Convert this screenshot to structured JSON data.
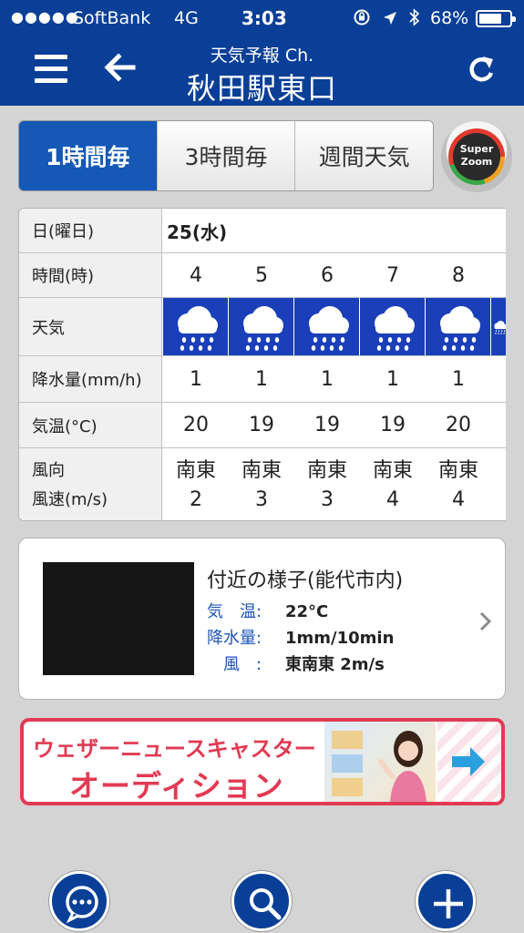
{
  "status_bar": {
    "signal": "●●●●●",
    "carrier": "SoftBank",
    "network": "4G",
    "time": "3:03",
    "battery_percent": "68%",
    "battery_level": 0.68
  },
  "header": {
    "subtitle": "天気予報 Ch.",
    "title": "秋田駅東口"
  },
  "tabs": [
    {
      "label": "1時間毎",
      "active": true
    },
    {
      "label": "3時間毎",
      "active": false
    },
    {
      "label": "週間天気",
      "active": false
    }
  ],
  "super_zoom": {
    "line1": "Super",
    "line2": "Zoom"
  },
  "forecast": {
    "labels": {
      "day": "日(曜日)",
      "hour": "時間(時)",
      "weather": "天気",
      "precip": "降水量(mm/h)",
      "temp": "気温(°C)",
      "wind_dir": "風向",
      "wind_speed": "風速(m/s)"
    },
    "day_value": "25(水)",
    "hours": [
      "4",
      "5",
      "6",
      "7",
      "8"
    ],
    "weather_icons": [
      "rain-cloud-icon",
      "rain-cloud-icon",
      "rain-cloud-icon",
      "rain-cloud-icon",
      "rain-cloud-icon"
    ],
    "precip": [
      "1",
      "1",
      "1",
      "1",
      "1"
    ],
    "temp": [
      "20",
      "19",
      "19",
      "19",
      "20"
    ],
    "wind_dir": [
      "南東",
      "南東",
      "南東",
      "南東",
      "南東"
    ],
    "wind_speed": [
      "2",
      "3",
      "3",
      "4",
      "4"
    ]
  },
  "nearby": {
    "title": "付近の様子(能代市内)",
    "temp_label": "気　温:",
    "temp_value": "22°C",
    "precip_label": "降水量:",
    "precip_value": "1mm/10min",
    "wind_label": "　風　:",
    "wind_value": "東南東 2m/s"
  },
  "banner": {
    "line1": "ウェザーニュースキャスター",
    "line2": "オーディション"
  },
  "colors": {
    "header_blue": "#0a3f97",
    "tab_active": "#1558b6",
    "banner_red": "#e23a53",
    "weather_cell": "#1a3fb8"
  }
}
